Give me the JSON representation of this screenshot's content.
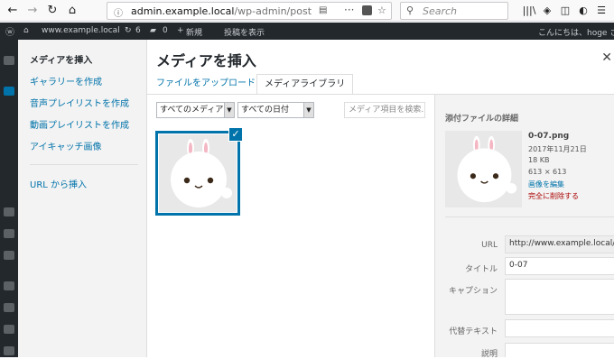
{
  "browser": {
    "url_host": "admin.example.local",
    "url_path": "/wp-admin/post",
    "search_placeholder": "Search"
  },
  "adminbar": {
    "site": "www.example.local",
    "updates": "6",
    "comments": "0",
    "new": "新規",
    "view": "投稿を表示",
    "greeting": "こんにちは、hoge さ"
  },
  "modal": {
    "title": "メディアを挿入",
    "menu": [
      {
        "label": "メディアを挿入"
      },
      {
        "label": "ギャラリーを作成"
      },
      {
        "label": "音声プレイリストを作成"
      },
      {
        "label": "動画プレイリストを作成"
      },
      {
        "label": "アイキャッチ画像"
      },
      {
        "label": "URL から挿入"
      }
    ],
    "tabs": [
      {
        "label": "ファイルをアップロード"
      },
      {
        "label": "メディアライブラリ"
      }
    ],
    "filters": {
      "type": "すべてのメディア",
      "date": "すべての日付",
      "search_placeholder": "メディア項目を検索..."
    }
  },
  "details": {
    "heading": "添付ファイルの詳細",
    "filename": "0-07.png",
    "date": "2017年11月21日",
    "size": "18 KB",
    "dimensions": "613 × 613",
    "edit_link": "画像を編集",
    "delete_link": "完全に削除する",
    "fields": {
      "url_label": "URL",
      "url_value": "http://www.example.local/im",
      "title_label": "タイトル",
      "title_value": "0-07",
      "caption_label": "キャプション",
      "caption_value": "",
      "alt_label": "代替テキスト",
      "alt_value": "",
      "desc_label": "説明"
    }
  },
  "colors": {
    "accent": "#0073aa",
    "delete": "#a00000",
    "adminbar": "#23282d"
  }
}
